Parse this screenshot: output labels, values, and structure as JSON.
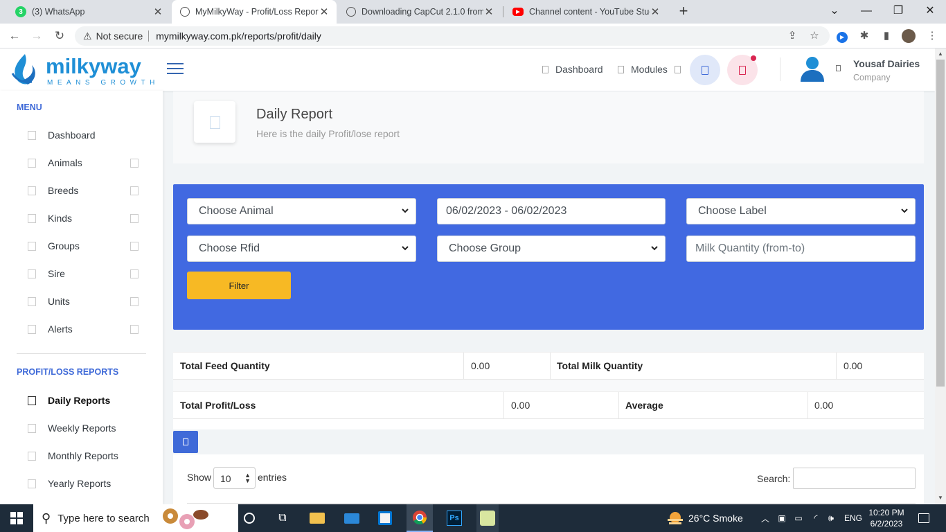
{
  "browser": {
    "tabs": [
      {
        "title": "(3) WhatsApp",
        "icon": "whatsapp-icon",
        "active": false
      },
      {
        "title": "MyMilkyWay - Profit/Loss Report",
        "icon": "globe-icon",
        "active": true
      },
      {
        "title": "Downloading CapCut 2.1.0 from",
        "icon": "globe-icon",
        "active": false
      },
      {
        "title": "Channel content - YouTube Studi",
        "icon": "youtube-icon",
        "active": false
      }
    ],
    "security_label": "Not secure",
    "url": "mymilkyway.com.pk/reports/profit/daily"
  },
  "header": {
    "logo_text": "milkyway",
    "logo_tagline": "MEANS GROWTH",
    "nav": [
      {
        "label": "Dashboard"
      },
      {
        "label": "Modules"
      }
    ],
    "user_name": "Yousaf Dairies",
    "user_role": "Company"
  },
  "sidebar": {
    "menu_heading": "MENU",
    "menu_items": [
      {
        "label": "Dashboard",
        "has_caret": false
      },
      {
        "label": "Animals",
        "has_caret": true
      },
      {
        "label": "Breeds",
        "has_caret": true
      },
      {
        "label": "Kinds",
        "has_caret": true
      },
      {
        "label": "Groups",
        "has_caret": true
      },
      {
        "label": "Sire",
        "has_caret": true
      },
      {
        "label": "Units",
        "has_caret": true
      },
      {
        "label": "Alerts",
        "has_caret": true
      }
    ],
    "reports_heading": "PROFIT/LOSS REPORTS",
    "report_items": [
      {
        "label": "Daily Reports",
        "active": true
      },
      {
        "label": "Weekly Reports",
        "active": false
      },
      {
        "label": "Monthly Reports",
        "active": false
      },
      {
        "label": "Yearly Reports",
        "active": false
      }
    ]
  },
  "page": {
    "title": "Daily Report",
    "subtitle": "Here is the daily Profit/lose report"
  },
  "filters": {
    "animal_select": "Choose Animal",
    "date_range": "06/02/2023 - 06/02/2023",
    "label_select": "Choose Label",
    "rfid_select": "Choose Rfid",
    "group_select": "Choose Group",
    "milk_quantity_placeholder": "Milk Quantity (from-to)",
    "filter_button": "Filter"
  },
  "stats": {
    "total_feed_quantity_label": "Total Feed Quantity",
    "total_feed_quantity_value": "0.00",
    "total_milk_quantity_label": "Total Milk Quantity",
    "total_milk_quantity_value": "0.00",
    "total_profit_loss_label": "Total Profit/Loss",
    "total_profit_loss_value": "0.00",
    "average_label": "Average",
    "average_value": "0.00"
  },
  "table": {
    "show_label": "Show",
    "entries_value": "10",
    "entries_label": "entries",
    "search_label": "Search:"
  },
  "taskbar": {
    "search_placeholder": "Type here to search",
    "weather": "26°C  Smoke",
    "language": "ENG",
    "time": "10:20 PM",
    "date": "6/2/2023"
  },
  "colors": {
    "primary": "#4169e1",
    "accent_blue": "#3f6ad8",
    "warning": "#f7b924",
    "danger": "#d92550"
  }
}
